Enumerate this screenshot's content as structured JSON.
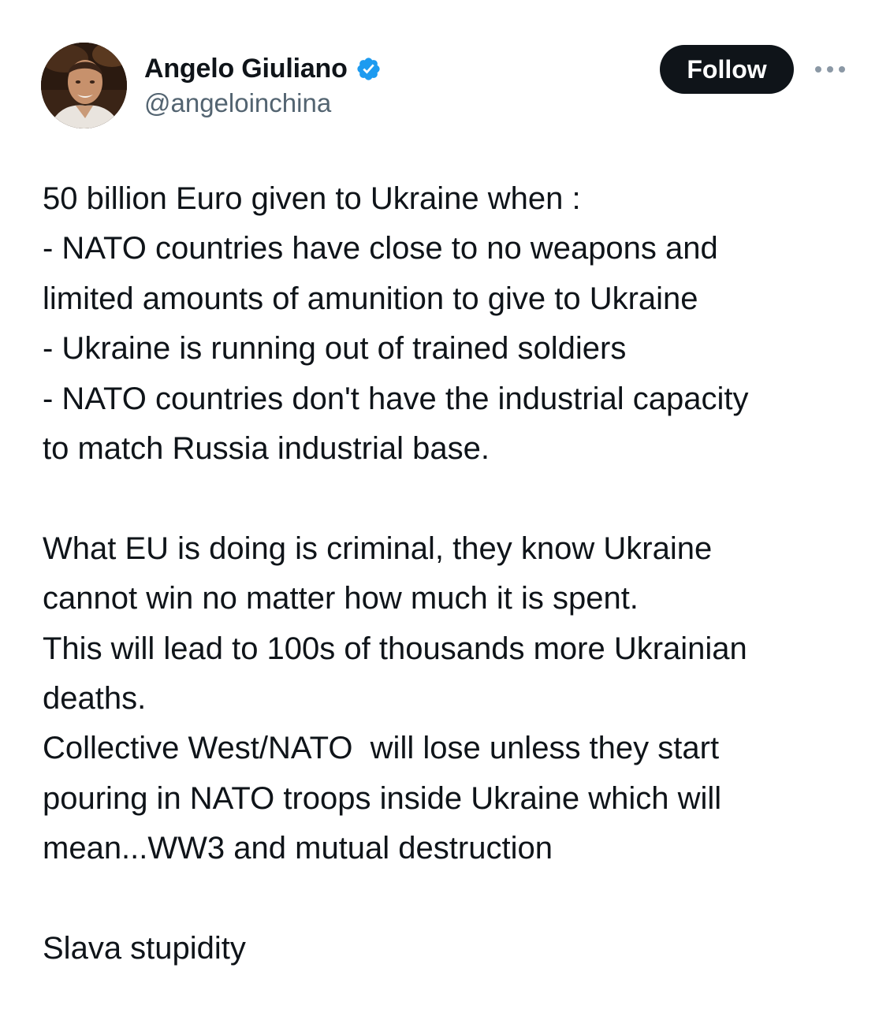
{
  "author": {
    "display_name": "Angelo Giuliano",
    "handle": "@angeloinchina",
    "verified": true,
    "avatar_icon": "user-photo-avatar"
  },
  "actions": {
    "follow_label": "Follow",
    "more_icon": "more-horizontal-icon"
  },
  "colors": {
    "text": "#0f1419",
    "secondary_text": "#536471",
    "verified_blue": "#1d9bf0",
    "follow_bg": "#0f1419",
    "background": "#ffffff"
  },
  "tweet": {
    "lines": [
      "50 billion Euro given to Ukraine when :",
      "- NATO countries have close to no weapons and",
      "limited amounts of amunition to give to Ukraine",
      "- Ukraine is running out of trained soldiers",
      "- NATO countries don't have the industrial capacity",
      "to match Russia industrial base.",
      "",
      "What EU is doing is criminal, they know Ukraine",
      "cannot win no matter how much it is spent.",
      "This will lead to 100s of thousands more Ukrainian",
      "deaths.",
      "Collective West/NATO  will lose unless they start",
      "pouring in NATO troops inside Ukraine which will",
      "mean...WW3 and mutual destruction",
      "",
      "Slava stupidity"
    ]
  }
}
